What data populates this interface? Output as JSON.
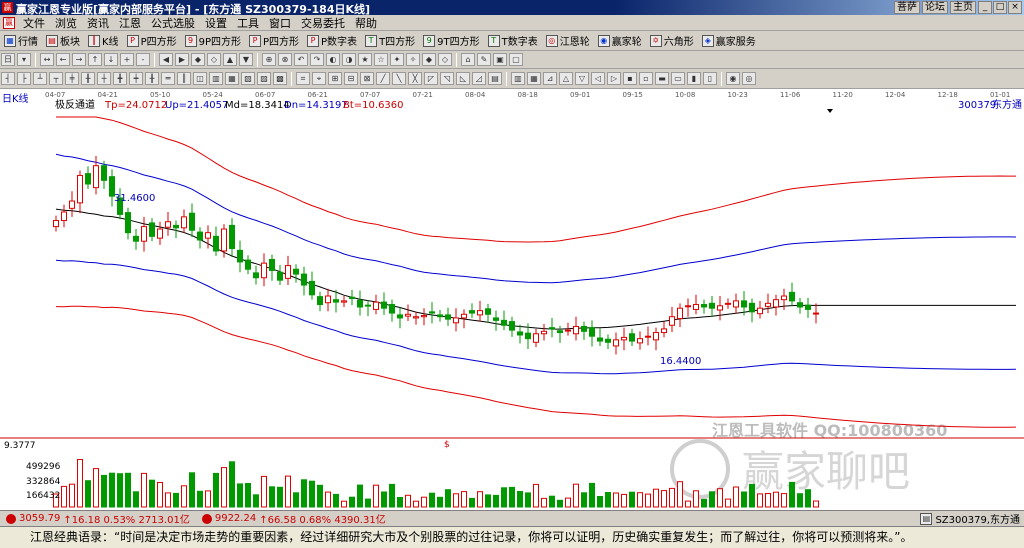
{
  "window": {
    "title": "赢家江恩专业版[赢家内部服务平台] - [东方通  SZ300379-184日K线]",
    "app_icon": "赢",
    "links": [
      "菩萨",
      "论坛",
      "主页"
    ],
    "controls": [
      "_",
      "□",
      "×"
    ]
  },
  "menu": {
    "logo": "赢",
    "items": [
      "文件",
      "浏览",
      "资讯",
      "江恩",
      "公式选股",
      "设置",
      "工具",
      "窗口",
      "交易委托",
      "帮助"
    ]
  },
  "toolbar1": [
    {
      "icon": "grid-icon",
      "label": "行情"
    },
    {
      "icon": "blocks-icon",
      "label": "板块"
    },
    {
      "icon": "candle-icon",
      "label": "K线"
    },
    {
      "icon": "p-square-icon",
      "label": "P四方形"
    },
    {
      "icon": "9p-square-icon",
      "label": "9P四方形"
    },
    {
      "icon": "p-square2-icon",
      "label": "P四方形"
    },
    {
      "icon": "p-table-icon",
      "label": "P数字表"
    },
    {
      "icon": "t-square-icon",
      "label": "T四方形"
    },
    {
      "icon": "9t-square-icon",
      "label": "9T四方形"
    },
    {
      "icon": "t-table-icon",
      "label": "T数字表"
    },
    {
      "icon": "gann-wheel-icon",
      "label": "江恩轮"
    },
    {
      "icon": "winner-wheel-icon",
      "label": "赢家轮"
    },
    {
      "icon": "hexagon-icon",
      "label": "六角形"
    },
    {
      "icon": "service-icon",
      "label": "赢家服务"
    }
  ],
  "chart_header": {
    "period": "日K线",
    "indicator": "极反通道",
    "tp": "Tp=24.0712",
    "up": "Up=21.4057",
    "md": "Md=18.3414",
    "dn": "Dn=14.3197",
    "bt": "Bt=10.6360",
    "code": "300379",
    "name": "东方通",
    "dates": [
      "04-07",
      "04-21",
      "05-10",
      "05-24",
      "06-07",
      "06-21",
      "07-07",
      "07-21",
      "08-04",
      "08-18",
      "09-01",
      "09-15",
      "10-08",
      "10-23",
      "11-06",
      "11-20",
      "12-04",
      "12-18",
      "01-01"
    ]
  },
  "annotations": {
    "high": "31.4600",
    "low": "16.4400",
    "vol_max": "9.3777",
    "vol_ticks": [
      "499296",
      "332864",
      "166432"
    ],
    "marker": "$",
    "watermark1": "江恩工具软件  QQ:100800360",
    "watermark2": "赢家聊吧"
  },
  "status": {
    "index1": "3059.79",
    "index1_chg": "↑16.18 0.53% 2713.01亿",
    "index2": "9922.24",
    "index2_chg": "↑66.58 0.68% 4390.31亿",
    "stock": "SZ300379,东方通"
  },
  "quote": "江恩经典语录：“时间是决定市场走势的重要因素，经过详细研究大市及个别股票的过往记录，你将可以证明，历史确实重复发生；而了解过往，你将可以预测将来。”。",
  "colors": {
    "up": "#e00000",
    "down": "#009900",
    "upper_band": "#e00000",
    "mid_band": "#0000d0",
    "median": "#000000"
  },
  "chart_data": {
    "type": "candlestick",
    "period": "daily",
    "price_range": [
      9.38,
      35
    ],
    "closes": [
      26.5,
      27.2,
      28.1,
      30.2,
      29.5,
      31.0,
      29.8,
      28.5,
      27.0,
      25.5,
      24.8,
      26.0,
      25.2,
      25.8,
      26.4,
      25.9,
      26.8,
      25.7,
      24.9,
      25.5,
      24.0,
      25.8,
      24.2,
      23.1,
      22.5,
      21.8,
      23.0,
      22.4,
      21.6,
      22.8,
      22.1,
      21.2,
      20.4,
      19.6,
      20.3,
      19.8,
      19.9,
      20.1,
      19.4,
      19.5,
      19.8,
      19.3,
      18.9,
      18.5,
      18.8,
      18.6,
      18.7,
      18.9,
      18.6,
      18.4,
      18.5,
      18.8,
      18.9,
      19.1,
      18.8,
      18.3,
      17.9,
      17.5,
      17.1,
      16.8,
      17.2,
      17.4,
      17.6,
      17.3,
      17.5,
      17.8,
      17.4,
      17.0,
      16.6,
      16.5,
      16.7,
      16.9,
      16.6,
      16.8,
      17.0,
      17.3,
      17.6,
      18.6,
      19.3,
      19.5,
      19.6,
      19.4,
      19.3,
      19.5,
      19.7,
      19.9,
      19.4,
      19.0,
      19.3,
      19.7,
      20.0,
      20.3,
      19.9,
      19.4,
      19.2,
      18.9
    ]
  }
}
